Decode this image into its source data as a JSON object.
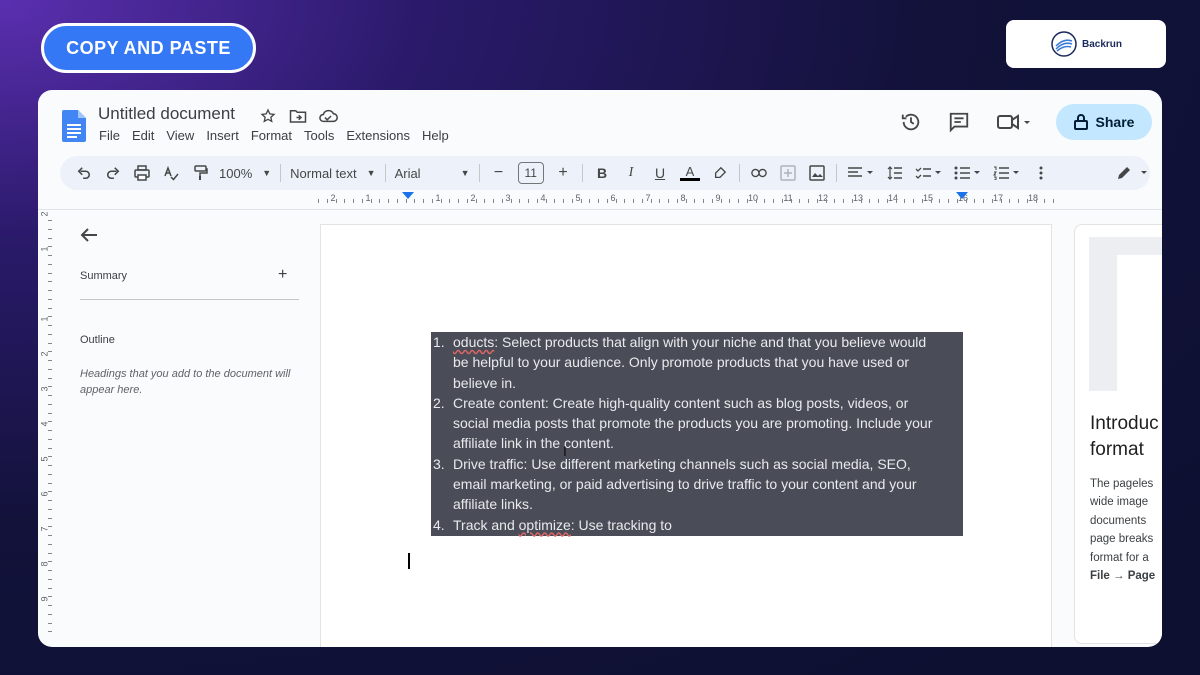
{
  "badge": {
    "label": "COPY AND PASTE"
  },
  "brand": {
    "name": "Backrun"
  },
  "doc": {
    "title": "Untitled document"
  },
  "menu": [
    "File",
    "Edit",
    "View",
    "Insert",
    "Format",
    "Tools",
    "Extensions",
    "Help"
  ],
  "share": {
    "label": "Share"
  },
  "toolbar": {
    "zoom": "100%",
    "style": "Normal text",
    "font": "Arial",
    "font_size": "11",
    "bold": "B",
    "italic": "I",
    "underline": "U",
    "text_color": "A"
  },
  "ruler": {
    "numbers": [
      "2",
      "1",
      "1",
      "2",
      "3",
      "4",
      "5",
      "6",
      "7",
      "8",
      "9",
      "10",
      "11",
      "12",
      "13",
      "14",
      "15",
      "16",
      "17",
      "18"
    ]
  },
  "vruler": {
    "numbers": [
      "2",
      "1",
      "1",
      "2",
      "3",
      "4",
      "5",
      "6",
      "7",
      "8",
      "9"
    ]
  },
  "sidebar": {
    "summary": "Summary",
    "outline": "Outline",
    "outline_hint": "Headings that you add to the document will appear here."
  },
  "content": {
    "items": [
      {
        "num": "1.",
        "lead": "oducts",
        "lines": [
          ": Select products that align with your niche and that you believe would",
          "be helpful to your audience. Only promote products that you have used or",
          "believe in."
        ]
      },
      {
        "num": "2.",
        "lines": [
          "Create content: Create high-quality content such as blog posts, videos, or",
          "social media posts that promote the products you are promoting. Include your",
          "affiliate link in the content."
        ]
      },
      {
        "num": "3.",
        "lines": [
          "Drive traffic: Use different marketing channels such as social media, SEO,",
          "email marketing, or paid advertising to drive traffic to your content and your",
          "affiliate links."
        ]
      },
      {
        "num": "4.",
        "pre": "Track and ",
        "lead": "optimize",
        "lines": [
          ": Use tracking to"
        ]
      }
    ]
  },
  "rightpanel": {
    "title": "Introduc\nformat",
    "body": "The pageles\nwide image\ndocuments \npage breaks\nformat for a",
    "body_bold": "File → Page"
  },
  "colors": {
    "accent": "#3478f6",
    "share_bg": "#c2e7ff",
    "selection": "#4a4d57"
  }
}
